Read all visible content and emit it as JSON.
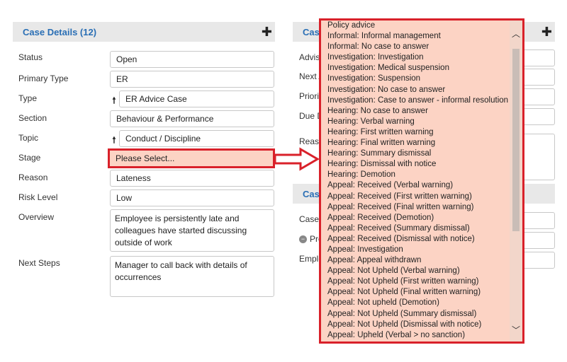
{
  "left_panel": {
    "title": "Case Details (12)",
    "fields": [
      {
        "label": "Status",
        "value": "Open"
      },
      {
        "label": "Primary Type",
        "value": "ER"
      },
      {
        "label": "Type",
        "value": "ER Advice Case"
      },
      {
        "label": "Section",
        "value": "Behaviour & Performance"
      },
      {
        "label": "Topic",
        "value": "Conduct / Discipline"
      },
      {
        "label": "Stage",
        "value": "Please Select..."
      },
      {
        "label": "Reason",
        "value": "Lateness"
      },
      {
        "label": "Risk Level",
        "value": "Low"
      }
    ],
    "overview_label": "Overview",
    "overview_text": "Employee is persistently late and colleagues have started discussing outside of work",
    "next_steps_label": "Next Steps",
    "next_steps_text": "Manager to call back with details of occurrences"
  },
  "right_panel": {
    "title": "Case",
    "labels": [
      "Advise",
      "Next A",
      "Priori",
      "Due D",
      "Reaso"
    ],
    "section2_title": "Case",
    "section2_labels": [
      "Case (",
      "Pre",
      "Emplo"
    ]
  },
  "icons": {
    "plus": "plus-icon",
    "up_arrow": "up-arrow-icon",
    "right_arrow": "right-arrow-icon"
  },
  "colors": {
    "title": "#2a6fb5",
    "highlight_bg": "#fcd3c4",
    "highlight_border": "#d9212a"
  },
  "stage_options": [
    "Policy advice",
    "Informal: Informal management",
    "Informal: No case to answer",
    "Investigation: Investigation",
    "Investigation: Medical suspension",
    "Investigation: Suspension",
    "Investigation: No case to answer",
    "Investigation: Case to answer - informal resolution",
    "Hearing: No case to answer",
    "Hearing: Verbal warning",
    "Hearing: First written warning",
    "Hearing: Final written warning",
    "Hearing: Summary dismissal",
    "Hearing: Dismissal with notice",
    "Hearing: Demotion",
    "Appeal: Received (Verbal warning)",
    "Appeal: Received (First written warning)",
    "Appeal: Received (Final written warning)",
    "Appeal: Received (Demotion)",
    "Appeal: Received (Summary dismissal)",
    "Appeal: Received (Dismissal with notice)",
    "Appeal: Investigation",
    "Appeal: Appeal withdrawn",
    "Appeal: Not Upheld (Verbal warning)",
    "Appeal: Not Upheld (First written warning)",
    "Appeal: Not Upheld (Final written warning)",
    "Appeal: Not upheld (Demotion)",
    "Appeal: Not Upheld (Summary dismissal)",
    "Appeal: Not Upheld (Dismissal with notice)",
    "Appeal: Upheld (Verbal > no sanction)"
  ]
}
